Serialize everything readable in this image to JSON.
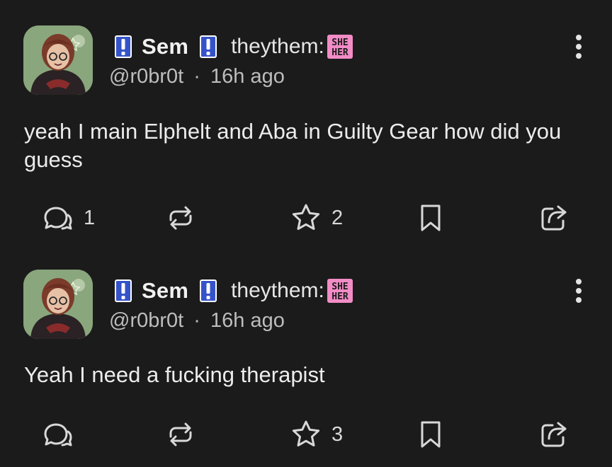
{
  "posts": [
    {
      "display_name": "Sem",
      "pronouns": "theythem:",
      "pronoun_badge": [
        "SHE",
        "HER"
      ],
      "handle": "@r0br0t",
      "separator": "·",
      "time_ago": "16h ago",
      "text": "yeah I main Elphelt and Aba in Guilty Gear how did you guess",
      "counts": {
        "replies": "1",
        "boosts": "",
        "favourites": "2"
      }
    },
    {
      "display_name": "Sem",
      "pronouns": "theythem:",
      "pronoun_badge": [
        "SHE",
        "HER"
      ],
      "handle": "@r0br0t",
      "separator": "·",
      "time_ago": "16h ago",
      "text": "Yeah I need a fucking therapist",
      "counts": {
        "replies": "",
        "boosts": "",
        "favourites": "3"
      }
    }
  ],
  "icons": {
    "flag_emoji": "exclamation-flag-icon",
    "pronoun_badge": "she-her-badge-icon",
    "menu": "more-vertical-icon",
    "reply": "reply-icon",
    "boost": "boost-icon",
    "favourite": "star-icon",
    "bookmark": "bookmark-icon",
    "share": "share-icon"
  },
  "colors": {
    "background": "#1b1b1b",
    "text": "#ececec",
    "secondary_text": "#bdbdbd",
    "badge_pink": "#f28cc6",
    "flag_blue": "#3553c9"
  }
}
